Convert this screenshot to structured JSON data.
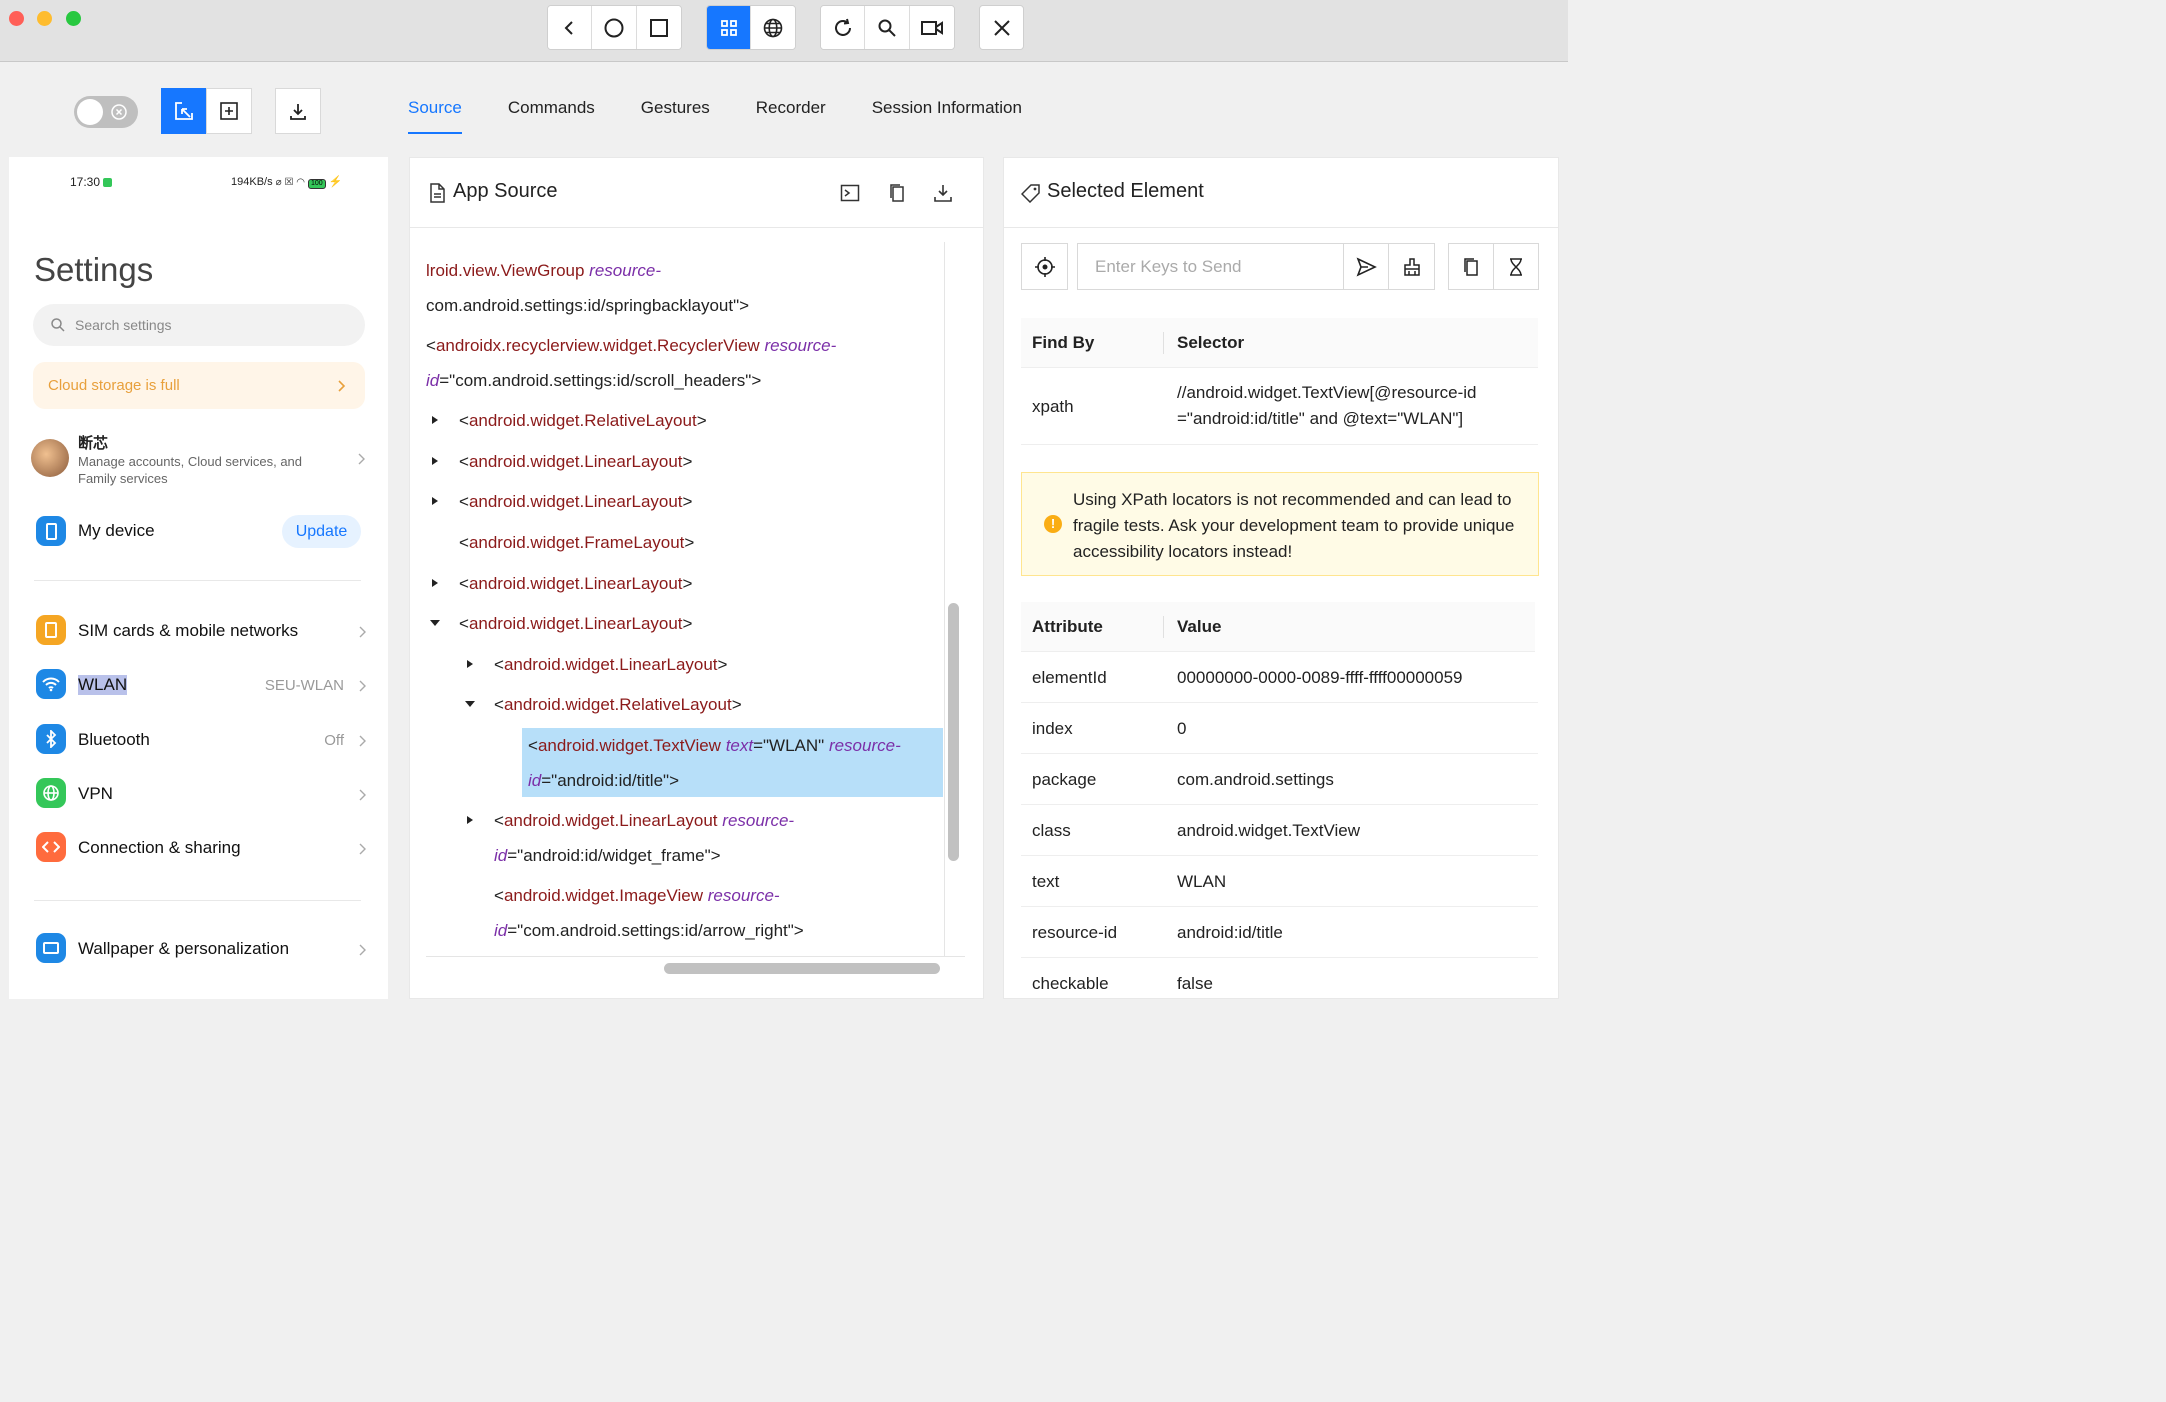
{
  "window": {
    "toolbar": {
      "nav": [
        "back-icon",
        "home-icon",
        "recent-apps-icon"
      ],
      "view": [
        "grid-icon",
        "globe-icon"
      ],
      "actions": [
        "refresh-icon",
        "search-icon",
        "video-icon"
      ],
      "close": "close-icon",
      "accent": "#1677ff"
    }
  },
  "controls": {
    "toggle_state": "off",
    "mode_buttons": [
      "select-element-icon",
      "add-region-icon"
    ],
    "download": "download-icon"
  },
  "tabs": [
    {
      "label": "Source",
      "active": true
    },
    {
      "label": "Commands"
    },
    {
      "label": "Gestures"
    },
    {
      "label": "Recorder"
    },
    {
      "label": "Session Information"
    }
  ],
  "phone": {
    "status": {
      "time": "17:30",
      "right": "194KB/s",
      "battery": "100"
    },
    "title": "Settings",
    "search_placeholder": "Search settings",
    "cloud_banner": "Cloud storage is full",
    "account": {
      "name": "断芯",
      "sub": "Manage accounts, Cloud services, and Family services"
    },
    "my_device": {
      "label": "My device",
      "button": "Update"
    },
    "items": [
      {
        "label": "SIM cards & mobile networks",
        "value": "",
        "color": "#f5a623"
      },
      {
        "label": "WLAN",
        "value": "SEU-WLAN",
        "color": "#1e88e5"
      },
      {
        "label": "Bluetooth",
        "value": "Off",
        "color": "#1e88e5"
      },
      {
        "label": "VPN",
        "value": "",
        "color": "#34c759"
      },
      {
        "label": "Connection & sharing",
        "value": "",
        "color": "#ff6b3d"
      },
      {
        "label": "Wallpaper & personalization",
        "value": "",
        "color": "#1e88e5"
      }
    ]
  },
  "source": {
    "title": "App Source",
    "lines": [
      {
        "pre": "",
        "tag": "lroid.view.ViewGroup",
        "attrs": [
          {
            "name": "resource-",
            "value": ""
          }
        ],
        "close": ""
      },
      {
        "pre": "",
        "tag": "",
        "attrs": [],
        "plain": "com.android.settings:id/springbacklayout\">"
      },
      {
        "pre": "<",
        "tag": "androidx.recyclerview.widget.RecyclerView",
        "attrs": [
          {
            "name": "resource-",
            "value": ""
          }
        ],
        "close": ""
      },
      {
        "pre": "",
        "tag": "",
        "attrs": [
          {
            "name": "id",
            "value": "=\"com.android.settings:id/scroll_headers\">"
          }
        ],
        "close": ""
      },
      {
        "pre": "<",
        "tag": "android.widget.RelativeLayout",
        "attrs": [],
        "close": ">"
      },
      {
        "pre": "<",
        "tag": "android.widget.LinearLayout",
        "attrs": [],
        "close": ">"
      },
      {
        "pre": "<",
        "tag": "android.widget.LinearLayout",
        "attrs": [],
        "close": ">"
      },
      {
        "pre": "<",
        "tag": "android.widget.FrameLayout",
        "attrs": [],
        "close": ">"
      },
      {
        "pre": "<",
        "tag": "android.widget.LinearLayout",
        "attrs": [],
        "close": ">"
      },
      {
        "pre": "<",
        "tag": "android.widget.LinearLayout",
        "attrs": [],
        "close": ">"
      },
      {
        "pre": "<",
        "tag": "android.widget.LinearLayout",
        "attrs": [],
        "close": ">"
      },
      {
        "pre": "<",
        "tag": "android.widget.RelativeLayout",
        "attrs": [],
        "close": ">"
      },
      {
        "pre": "<",
        "tag": "android.widget.TextView",
        "attrs": [
          {
            "name": "text",
            "value": "=\"WLAN\" "
          },
          {
            "name": "resource-",
            "value": ""
          }
        ],
        "close": ""
      },
      {
        "pre": "",
        "tag": "",
        "attrs": [
          {
            "name": "id",
            "value": "=\"android:id/title\">"
          }
        ],
        "close": ""
      },
      {
        "pre": "<",
        "tag": "android.widget.LinearLayout",
        "attrs": [
          {
            "name": "resource-",
            "value": ""
          }
        ],
        "close": ""
      },
      {
        "pre": "",
        "tag": "",
        "attrs": [
          {
            "name": "id",
            "value": "=\"android:id/widget_frame\">"
          }
        ],
        "close": ""
      },
      {
        "pre": "<",
        "tag": "android.widget.ImageView",
        "attrs": [
          {
            "name": "resource-",
            "value": ""
          }
        ],
        "close": ""
      },
      {
        "pre": "",
        "tag": "",
        "attrs": [
          {
            "name": "id",
            "value": "=\"com.android.settings:id/arrow_right\">"
          }
        ],
        "close": ""
      }
    ]
  },
  "selected": {
    "title": "Selected Element",
    "input_placeholder": "Enter Keys to Send",
    "find_by_header": "Find By",
    "selector_header": "Selector",
    "find_by": "xpath",
    "selector_line1": "//android.widget.TextView[@resource-id",
    "selector_line2": "=\"android:id/title\" and @text=\"WLAN\"]",
    "warning": "Using XPath locators is not recommended and can lead to fragile tests. Ask your development team to provide unique accessibility locators instead!",
    "attr_header": "Attribute",
    "value_header": "Value",
    "attributes": [
      {
        "name": "elementId",
        "value": "00000000-0000-0089-ffff-ffff00000059"
      },
      {
        "name": "index",
        "value": "0"
      },
      {
        "name": "package",
        "value": "com.android.settings"
      },
      {
        "name": "class",
        "value": "android.widget.TextView"
      },
      {
        "name": "text",
        "value": "WLAN"
      },
      {
        "name": "resource-id",
        "value": "android:id/title"
      },
      {
        "name": "checkable",
        "value": "false"
      }
    ]
  }
}
